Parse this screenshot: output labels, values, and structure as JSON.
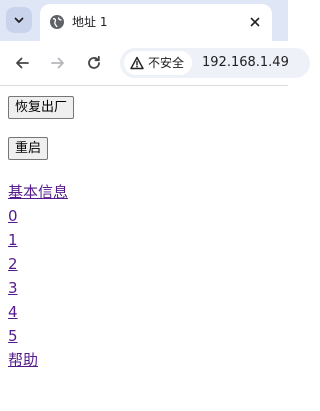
{
  "browser": {
    "tab": {
      "title": "地址 1"
    },
    "omnibox": {
      "security_label": "不安全",
      "url": "192.168.1.49"
    }
  },
  "page": {
    "buttons": {
      "factory_reset": "恢复出厂",
      "reboot": "重启"
    },
    "links": [
      "基本信息",
      "0",
      "1",
      "2",
      "3",
      "4",
      "5",
      "帮助"
    ]
  }
}
